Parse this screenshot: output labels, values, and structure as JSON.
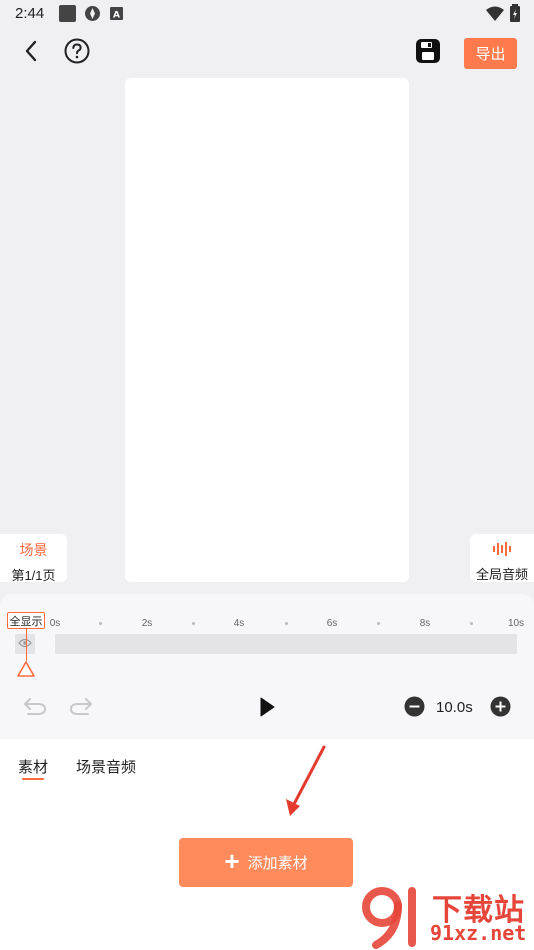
{
  "status_bar": {
    "time": "2:44"
  },
  "toolbar": {
    "back_icon": "arrow-left-icon",
    "help_icon": "question-circle-icon",
    "save_icon": "save-icon",
    "export_label": "导出"
  },
  "scene_card": {
    "title": "场景",
    "page": "第1/1页"
  },
  "global_audio": {
    "label": "全局音频",
    "icon": "waveform-icon"
  },
  "timeline": {
    "fit_label": "全显示",
    "ticks": [
      "0s",
      "2s",
      "4s",
      "6s",
      "8s",
      "10s"
    ]
  },
  "controls": {
    "duration": "10.0s"
  },
  "tabs": {
    "material": "素材",
    "scene_audio": "场景音频"
  },
  "add_material": {
    "label": "添加素材"
  },
  "watermark": {
    "brand_top": "下载站",
    "brand_bottom": "91xz.net"
  },
  "colors": {
    "accent": "#ff6a3d",
    "button": "#ff8a5c",
    "background": "#f0f0f3"
  }
}
